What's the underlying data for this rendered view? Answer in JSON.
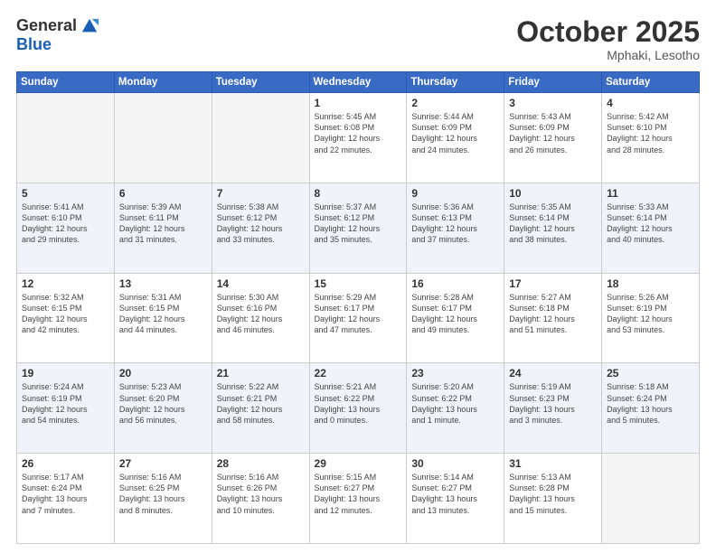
{
  "logo": {
    "general": "General",
    "blue": "Blue"
  },
  "header": {
    "month": "October 2025",
    "location": "Mphaki, Lesotho"
  },
  "weekdays": [
    "Sunday",
    "Monday",
    "Tuesday",
    "Wednesday",
    "Thursday",
    "Friday",
    "Saturday"
  ],
  "weeks": [
    [
      {
        "day": "",
        "text": ""
      },
      {
        "day": "",
        "text": ""
      },
      {
        "day": "",
        "text": ""
      },
      {
        "day": "1",
        "text": "Sunrise: 5:45 AM\nSunset: 6:08 PM\nDaylight: 12 hours\nand 22 minutes."
      },
      {
        "day": "2",
        "text": "Sunrise: 5:44 AM\nSunset: 6:09 PM\nDaylight: 12 hours\nand 24 minutes."
      },
      {
        "day": "3",
        "text": "Sunrise: 5:43 AM\nSunset: 6:09 PM\nDaylight: 12 hours\nand 26 minutes."
      },
      {
        "day": "4",
        "text": "Sunrise: 5:42 AM\nSunset: 6:10 PM\nDaylight: 12 hours\nand 28 minutes."
      }
    ],
    [
      {
        "day": "5",
        "text": "Sunrise: 5:41 AM\nSunset: 6:10 PM\nDaylight: 12 hours\nand 29 minutes."
      },
      {
        "day": "6",
        "text": "Sunrise: 5:39 AM\nSunset: 6:11 PM\nDaylight: 12 hours\nand 31 minutes."
      },
      {
        "day": "7",
        "text": "Sunrise: 5:38 AM\nSunset: 6:12 PM\nDaylight: 12 hours\nand 33 minutes."
      },
      {
        "day": "8",
        "text": "Sunrise: 5:37 AM\nSunset: 6:12 PM\nDaylight: 12 hours\nand 35 minutes."
      },
      {
        "day": "9",
        "text": "Sunrise: 5:36 AM\nSunset: 6:13 PM\nDaylight: 12 hours\nand 37 minutes."
      },
      {
        "day": "10",
        "text": "Sunrise: 5:35 AM\nSunset: 6:14 PM\nDaylight: 12 hours\nand 38 minutes."
      },
      {
        "day": "11",
        "text": "Sunrise: 5:33 AM\nSunset: 6:14 PM\nDaylight: 12 hours\nand 40 minutes."
      }
    ],
    [
      {
        "day": "12",
        "text": "Sunrise: 5:32 AM\nSunset: 6:15 PM\nDaylight: 12 hours\nand 42 minutes."
      },
      {
        "day": "13",
        "text": "Sunrise: 5:31 AM\nSunset: 6:15 PM\nDaylight: 12 hours\nand 44 minutes."
      },
      {
        "day": "14",
        "text": "Sunrise: 5:30 AM\nSunset: 6:16 PM\nDaylight: 12 hours\nand 46 minutes."
      },
      {
        "day": "15",
        "text": "Sunrise: 5:29 AM\nSunset: 6:17 PM\nDaylight: 12 hours\nand 47 minutes."
      },
      {
        "day": "16",
        "text": "Sunrise: 5:28 AM\nSunset: 6:17 PM\nDaylight: 12 hours\nand 49 minutes."
      },
      {
        "day": "17",
        "text": "Sunrise: 5:27 AM\nSunset: 6:18 PM\nDaylight: 12 hours\nand 51 minutes."
      },
      {
        "day": "18",
        "text": "Sunrise: 5:26 AM\nSunset: 6:19 PM\nDaylight: 12 hours\nand 53 minutes."
      }
    ],
    [
      {
        "day": "19",
        "text": "Sunrise: 5:24 AM\nSunset: 6:19 PM\nDaylight: 12 hours\nand 54 minutes."
      },
      {
        "day": "20",
        "text": "Sunrise: 5:23 AM\nSunset: 6:20 PM\nDaylight: 12 hours\nand 56 minutes."
      },
      {
        "day": "21",
        "text": "Sunrise: 5:22 AM\nSunset: 6:21 PM\nDaylight: 12 hours\nand 58 minutes."
      },
      {
        "day": "22",
        "text": "Sunrise: 5:21 AM\nSunset: 6:22 PM\nDaylight: 13 hours\nand 0 minutes."
      },
      {
        "day": "23",
        "text": "Sunrise: 5:20 AM\nSunset: 6:22 PM\nDaylight: 13 hours\nand 1 minute."
      },
      {
        "day": "24",
        "text": "Sunrise: 5:19 AM\nSunset: 6:23 PM\nDaylight: 13 hours\nand 3 minutes."
      },
      {
        "day": "25",
        "text": "Sunrise: 5:18 AM\nSunset: 6:24 PM\nDaylight: 13 hours\nand 5 minutes."
      }
    ],
    [
      {
        "day": "26",
        "text": "Sunrise: 5:17 AM\nSunset: 6:24 PM\nDaylight: 13 hours\nand 7 minutes."
      },
      {
        "day": "27",
        "text": "Sunrise: 5:16 AM\nSunset: 6:25 PM\nDaylight: 13 hours\nand 8 minutes."
      },
      {
        "day": "28",
        "text": "Sunrise: 5:16 AM\nSunset: 6:26 PM\nDaylight: 13 hours\nand 10 minutes."
      },
      {
        "day": "29",
        "text": "Sunrise: 5:15 AM\nSunset: 6:27 PM\nDaylight: 13 hours\nand 12 minutes."
      },
      {
        "day": "30",
        "text": "Sunrise: 5:14 AM\nSunset: 6:27 PM\nDaylight: 13 hours\nand 13 minutes."
      },
      {
        "day": "31",
        "text": "Sunrise: 5:13 AM\nSunset: 6:28 PM\nDaylight: 13 hours\nand 15 minutes."
      },
      {
        "day": "",
        "text": ""
      }
    ]
  ]
}
